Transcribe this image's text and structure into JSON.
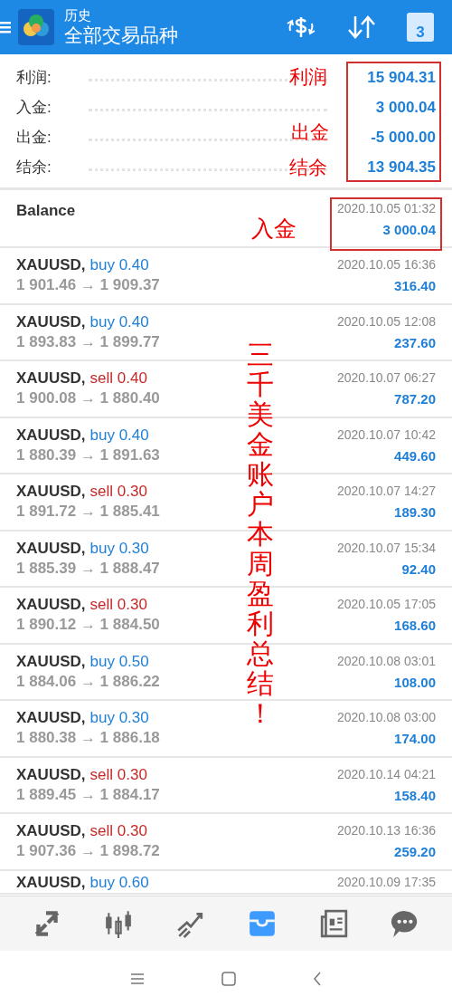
{
  "header": {
    "title": "历史",
    "subtitle": "全部交易品种",
    "calendar_day": "3"
  },
  "summary": [
    {
      "label": "利润:",
      "value": "15 904.31"
    },
    {
      "label": "入金:",
      "value": "3 000.04"
    },
    {
      "label": "出金:",
      "value": "-5 000.00"
    },
    {
      "label": "结余:",
      "value": "13 904.35"
    }
  ],
  "balance": {
    "label": "Balance",
    "time": "2020.10.05 01:32",
    "amount": "3 000.04"
  },
  "trades": [
    {
      "symbol": "XAUUSD,",
      "kind": "buy",
      "order": "buy 0.40",
      "prices": "1 901.46 → 1 909.37",
      "time": "2020.10.05 16:36",
      "profit": "316.40"
    },
    {
      "symbol": "XAUUSD,",
      "kind": "buy",
      "order": "buy 0.40",
      "prices": "1 893.83 → 1 899.77",
      "time": "2020.10.05 12:08",
      "profit": "237.60"
    },
    {
      "symbol": "XAUUSD,",
      "kind": "sell",
      "order": "sell 0.40",
      "prices": "1 900.08 → 1 880.40",
      "time": "2020.10.07 06:27",
      "profit": "787.20"
    },
    {
      "symbol": "XAUUSD,",
      "kind": "buy",
      "order": "buy 0.40",
      "prices": "1 880.39 → 1 891.63",
      "time": "2020.10.07 10:42",
      "profit": "449.60"
    },
    {
      "symbol": "XAUUSD,",
      "kind": "sell",
      "order": "sell 0.30",
      "prices": "1 891.72 → 1 885.41",
      "time": "2020.10.07 14:27",
      "profit": "189.30"
    },
    {
      "symbol": "XAUUSD,",
      "kind": "buy",
      "order": "buy 0.30",
      "prices": "1 885.39 → 1 888.47",
      "time": "2020.10.07 15:34",
      "profit": "92.40"
    },
    {
      "symbol": "XAUUSD,",
      "kind": "sell",
      "order": "sell 0.30",
      "prices": "1 890.12 → 1 884.50",
      "time": "2020.10.05 17:05",
      "profit": "168.60"
    },
    {
      "symbol": "XAUUSD,",
      "kind": "buy",
      "order": "buy 0.50",
      "prices": "1 884.06 → 1 886.22",
      "time": "2020.10.08 03:01",
      "profit": "108.00"
    },
    {
      "symbol": "XAUUSD,",
      "kind": "buy",
      "order": "buy 0.30",
      "prices": "1 880.38 → 1 886.18",
      "time": "2020.10.08 03:00",
      "profit": "174.00"
    },
    {
      "symbol": "XAUUSD,",
      "kind": "sell",
      "order": "sell 0.30",
      "prices": "1 889.45 → 1 884.17",
      "time": "2020.10.14 04:21",
      "profit": "158.40"
    },
    {
      "symbol": "XAUUSD,",
      "kind": "sell",
      "order": "sell 0.30",
      "prices": "1 907.36 → 1 898.72",
      "time": "2020.10.13 16:36",
      "profit": "259.20"
    },
    {
      "symbol": "XAUUSD,",
      "kind": "buy",
      "order": "buy 0.60",
      "time": "2020.10.09 17:35"
    }
  ],
  "bottom_nav": [
    {
      "kind": "quotes",
      "selected": false
    },
    {
      "kind": "chart",
      "selected": false
    },
    {
      "kind": "trade",
      "selected": false
    },
    {
      "kind": "history",
      "selected": true
    },
    {
      "kind": "news",
      "selected": false
    },
    {
      "kind": "chat",
      "selected": false
    }
  ],
  "annotations": {
    "profit": "利润",
    "withdrawal": "出金",
    "balance": "结余",
    "deposit": "入金",
    "caption": "三千美金账户本周盈利总结！"
  }
}
